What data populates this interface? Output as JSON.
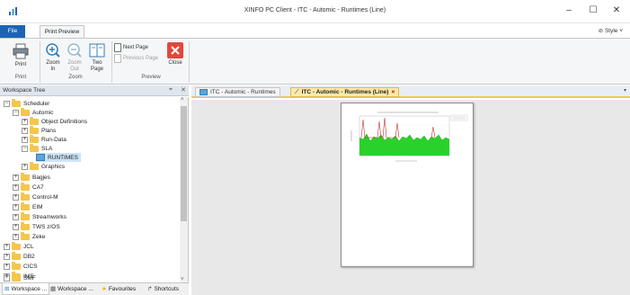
{
  "window": {
    "title": "XINFO PC Client - ITC - Automic - Runtimes (Line)",
    "minimize": "–",
    "maximize": "☐",
    "close": "✕"
  },
  "ribbon_tabs": {
    "file": "File",
    "print_preview": "Print Preview",
    "style": "Style"
  },
  "ribbon": {
    "print": "Print",
    "zoom_in_1": "Zoom",
    "zoom_in_2": "In",
    "zoom_out_1": "Zoom",
    "zoom_out_2": "Out",
    "two_page_1": "Two",
    "two_page_2": "Page",
    "next_page": "Next Page",
    "previous_page": "Previous Page",
    "close": "Close",
    "groups": {
      "print": "Print",
      "zoom": "Zoom",
      "preview": "Preview"
    }
  },
  "workspace_tree": {
    "title": "Workspace Tree",
    "pin": "⌖",
    "close": "✕",
    "nodes": {
      "scheduler": "Scheduler",
      "automic": "Automic",
      "object_definitions": "Object Definitions",
      "plans": "Plans",
      "run_data": "Run-Data",
      "sla": "SLA",
      "runtimes": "RUNTIMES",
      "graphics": "Graphics",
      "bagjes": "Bagjes",
      "ca7": "CA7",
      "control_m": "Control-M",
      "eim": "EIM",
      "streamworks": "Streamworks",
      "tws_zos": "TWS z/OS",
      "zeke": "Zeke",
      "jcl": "JCL",
      "db2": "DB2",
      "cics": "CICS",
      "ims": "IMS",
      "smf": "SMF"
    }
  },
  "bottom_tabs": {
    "workspace1": "Workspace ...",
    "workspace2": "Workspace ...",
    "favourites": "Favourites",
    "shortcuts": "Shortcuts"
  },
  "doc_tabs": {
    "tab1": "ITC - Automic - Runtimes",
    "tab2": "ITC - Automic - Runtimes (Line)",
    "tab2_close": "×"
  },
  "colors": {
    "file_tab": "#1e64b4",
    "active_doc_tab": "#fde9a9",
    "folder": "#f4c64e",
    "close_button": "#e0483a"
  }
}
